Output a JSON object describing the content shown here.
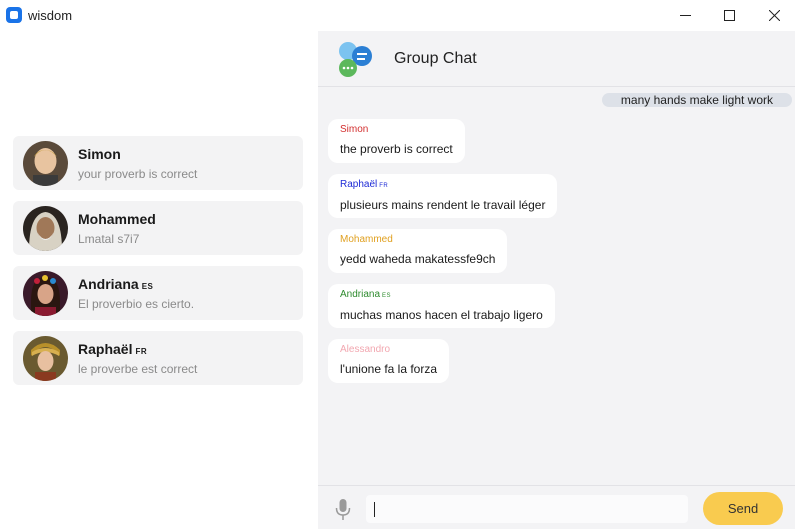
{
  "app": {
    "title": "wisdom"
  },
  "contacts": [
    {
      "name": "Simon",
      "lang": "",
      "message": "your proverb is correct"
    },
    {
      "name": "Mohammed",
      "lang": "",
      "message": "Lmatal s7i7"
    },
    {
      "name": "Andriana",
      "lang": "ES",
      "message": "El proverbio es cierto."
    },
    {
      "name": "Raphaël",
      "lang": "FR",
      "message": "le proverbe est correct"
    }
  ],
  "chat": {
    "title": "Group Chat",
    "own_message": "many hands make light work",
    "messages": [
      {
        "sender": "Simon",
        "lang": "",
        "color": "#d32f2f",
        "text": "the proverb is correct"
      },
      {
        "sender": "Raphaël",
        "lang": "FR",
        "color": "#1e2bd6",
        "text": "plusieurs mains rendent le travail léger"
      },
      {
        "sender": "Mohammed",
        "lang": "",
        "color": "#e0a020",
        "text": "yedd waheda makatessfe9ch"
      },
      {
        "sender": "Andriana",
        "lang": "ES",
        "color": "#2e8b2e",
        "text": "muchas manos hacen el trabajo ligero"
      },
      {
        "sender": "Alessandro",
        "lang": "",
        "color": "#f2a7b0",
        "text": "l'unione fa la forza"
      }
    ]
  },
  "input": {
    "placeholder": "",
    "value": ""
  },
  "buttons": {
    "send": "Send"
  },
  "icons": {
    "app": "app-icon",
    "minimize": "minimize-icon",
    "maximize": "maximize-icon",
    "close": "close-icon",
    "group": "group-chat-icon",
    "mic": "microphone-icon"
  }
}
